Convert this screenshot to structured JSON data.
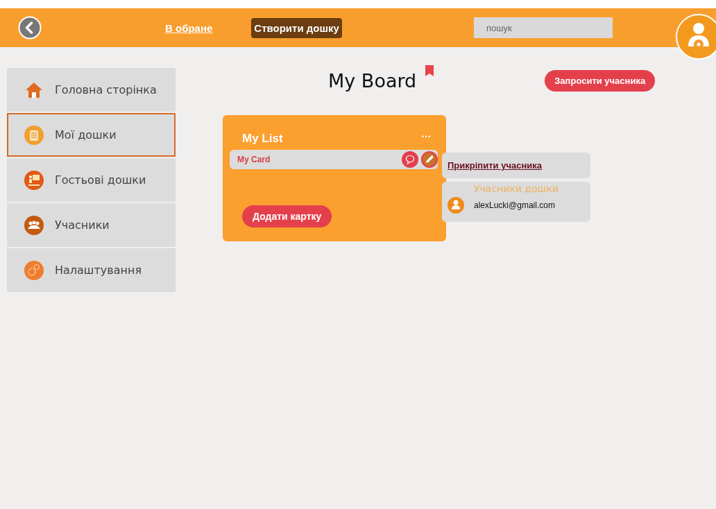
{
  "header": {
    "favorites_link": "В обране",
    "create_button": "Створити дошку",
    "search": {
      "placeholder": "пошук"
    }
  },
  "sidebar": {
    "items": [
      {
        "label": "Головна сторінка",
        "selected": false
      },
      {
        "label": "Мої дошки",
        "selected": true
      },
      {
        "label": "Гостьові дошки",
        "selected": false
      },
      {
        "label": "Учасники",
        "selected": false
      },
      {
        "label": "Налаштування",
        "selected": false
      }
    ]
  },
  "board": {
    "title": "My Board",
    "bookmarked": true,
    "invite_button": "Запросити учасника",
    "list": {
      "title": "My List",
      "menu": "···",
      "cards": [
        {
          "title": "My Card"
        }
      ],
      "add_button": "Додати картку"
    },
    "attach_member_link": "Прикріпити учасника",
    "members_panel": {
      "title": "Учасники дошки",
      "members": [
        {
          "email": "alexLucki@gmail.com"
        }
      ]
    }
  }
}
